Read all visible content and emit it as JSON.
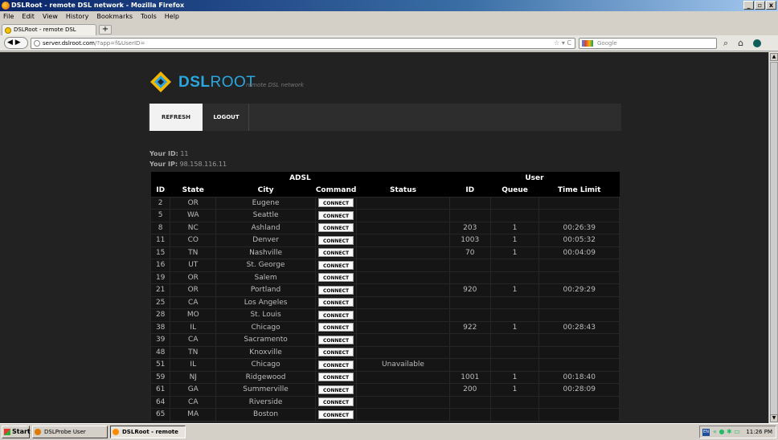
{
  "window": {
    "title": "DSLRoot - remote DSL network - Mozilla Firefox",
    "buttons": [
      "_",
      "▫",
      "x"
    ]
  },
  "menubar": [
    "File",
    "Edit",
    "View",
    "History",
    "Bookmarks",
    "Tools",
    "Help"
  ],
  "tab": {
    "label": "DSLRoot - remote DSL network",
    "new_tab": "+"
  },
  "navbar": {
    "back_forward": "◀ ▶",
    "url_host": "server.dslroot.com",
    "url_path": "/?app=f&UserID=",
    "url_icons": "☆ ▾ C",
    "search_placeholder": "Google",
    "search_icon": "⌕",
    "home_icon": "⌂"
  },
  "page": {
    "brand_dsl": "DSL",
    "brand_root": "ROOT",
    "tagline": "remote DSL network",
    "menu": {
      "refresh": "REFRESH",
      "logout": "LOGOUT"
    },
    "your_id_label": "Your ID:",
    "your_id": "11",
    "your_ip_label": "Your IP:",
    "your_ip": "98.158.116.11",
    "group_adsl": "ADSL",
    "group_user": "User",
    "headers": [
      "ID",
      "State",
      "City",
      "Command",
      "Status",
      "ID",
      "Queue",
      "Time Limit"
    ],
    "connect_label": "CONNECT",
    "rows": [
      {
        "id": "2",
        "state": "OR",
        "city": "Eugene",
        "status": "",
        "uid": "",
        "queue": "",
        "time": ""
      },
      {
        "id": "5",
        "state": "WA",
        "city": "Seattle",
        "status": "",
        "uid": "",
        "queue": "",
        "time": ""
      },
      {
        "id": "8",
        "state": "NC",
        "city": "Ashland",
        "status": "",
        "uid": "203",
        "queue": "1",
        "time": "00:26:39"
      },
      {
        "id": "11",
        "state": "CO",
        "city": "Denver",
        "status": "",
        "uid": "1003",
        "queue": "1",
        "time": "00:05:32"
      },
      {
        "id": "15",
        "state": "TN",
        "city": "Nashville",
        "status": "",
        "uid": "70",
        "queue": "1",
        "time": "00:04:09"
      },
      {
        "id": "16",
        "state": "UT",
        "city": "St. George",
        "status": "",
        "uid": "",
        "queue": "",
        "time": ""
      },
      {
        "id": "19",
        "state": "OR",
        "city": "Salem",
        "status": "",
        "uid": "",
        "queue": "",
        "time": ""
      },
      {
        "id": "21",
        "state": "OR",
        "city": "Portland",
        "status": "",
        "uid": "920",
        "queue": "1",
        "time": "00:29:29"
      },
      {
        "id": "25",
        "state": "CA",
        "city": "Los Angeles",
        "status": "",
        "uid": "",
        "queue": "",
        "time": ""
      },
      {
        "id": "28",
        "state": "MO",
        "city": "St. Louis",
        "status": "",
        "uid": "",
        "queue": "",
        "time": ""
      },
      {
        "id": "38",
        "state": "IL",
        "city": "Chicago",
        "status": "",
        "uid": "922",
        "queue": "1",
        "time": "00:28:43"
      },
      {
        "id": "39",
        "state": "CA",
        "city": "Sacramento",
        "status": "",
        "uid": "",
        "queue": "",
        "time": ""
      },
      {
        "id": "48",
        "state": "TN",
        "city": "Knoxville",
        "status": "",
        "uid": "",
        "queue": "",
        "time": ""
      },
      {
        "id": "51",
        "state": "IL",
        "city": "Chicago",
        "status": "Unavailable",
        "uid": "",
        "queue": "",
        "time": ""
      },
      {
        "id": "59",
        "state": "NJ",
        "city": "Ridgewood",
        "status": "",
        "uid": "1001",
        "queue": "1",
        "time": "00:18:40"
      },
      {
        "id": "61",
        "state": "GA",
        "city": "Summerville",
        "status": "",
        "uid": "200",
        "queue": "1",
        "time": "00:28:09"
      },
      {
        "id": "64",
        "state": "CA",
        "city": "Riverside",
        "status": "",
        "uid": "",
        "queue": "",
        "time": ""
      },
      {
        "id": "65",
        "state": "MA",
        "city": "Boston",
        "status": "",
        "uid": "",
        "queue": "",
        "time": ""
      }
    ]
  },
  "taskbar": {
    "start": "Start",
    "tasks": [
      "DSLProbe User Manual | ...",
      "DSLRoot - remote DS..."
    ],
    "lang": "EN",
    "tray_icons": "« ● ✱ ▭",
    "clock": "11:26 PM"
  },
  "colors": {
    "brand_blue": "#2aa7e0",
    "logo_yellow": "#f5b800",
    "page_bg": "#222222"
  }
}
